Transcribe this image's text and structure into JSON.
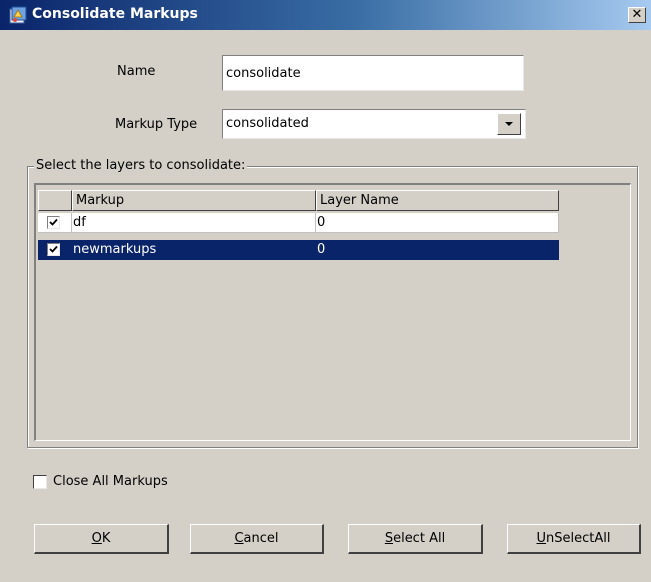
{
  "window": {
    "title": "Consolidate Markups",
    "close_glyph": "✕",
    "app_icon": "consolidate-app-icon"
  },
  "form": {
    "name_label": "Name",
    "name_value": "consolidate",
    "markup_type_label": "Markup Type",
    "markup_type_value": "consolidated"
  },
  "layers": {
    "group_title": "Select the layers to consolidate:",
    "columns": [
      "Markup",
      "Layer Name"
    ],
    "rows": [
      {
        "markup": "df",
        "layer_name": "0",
        "checked": true,
        "selected": false
      },
      {
        "markup": "newmarkups",
        "layer_name": "0",
        "checked": true,
        "selected": true
      }
    ]
  },
  "options": {
    "close_all_label": "Close All Markups",
    "close_all_checked": false
  },
  "buttons": {
    "ok": {
      "mnemonic": "O",
      "rest": "K"
    },
    "cancel": {
      "mnemonic": "C",
      "rest": "ancel"
    },
    "select_all": {
      "mnemonic": "S",
      "rest": "elect All"
    },
    "unselect_all": {
      "mnemonic": "U",
      "rest": "nSelectAll"
    }
  },
  "colors": {
    "dialog_bg": "#d4d0c8",
    "title_gradient_start": "#0a246a",
    "title_gradient_end": "#a6caf0",
    "selection": "#0a246a"
  }
}
